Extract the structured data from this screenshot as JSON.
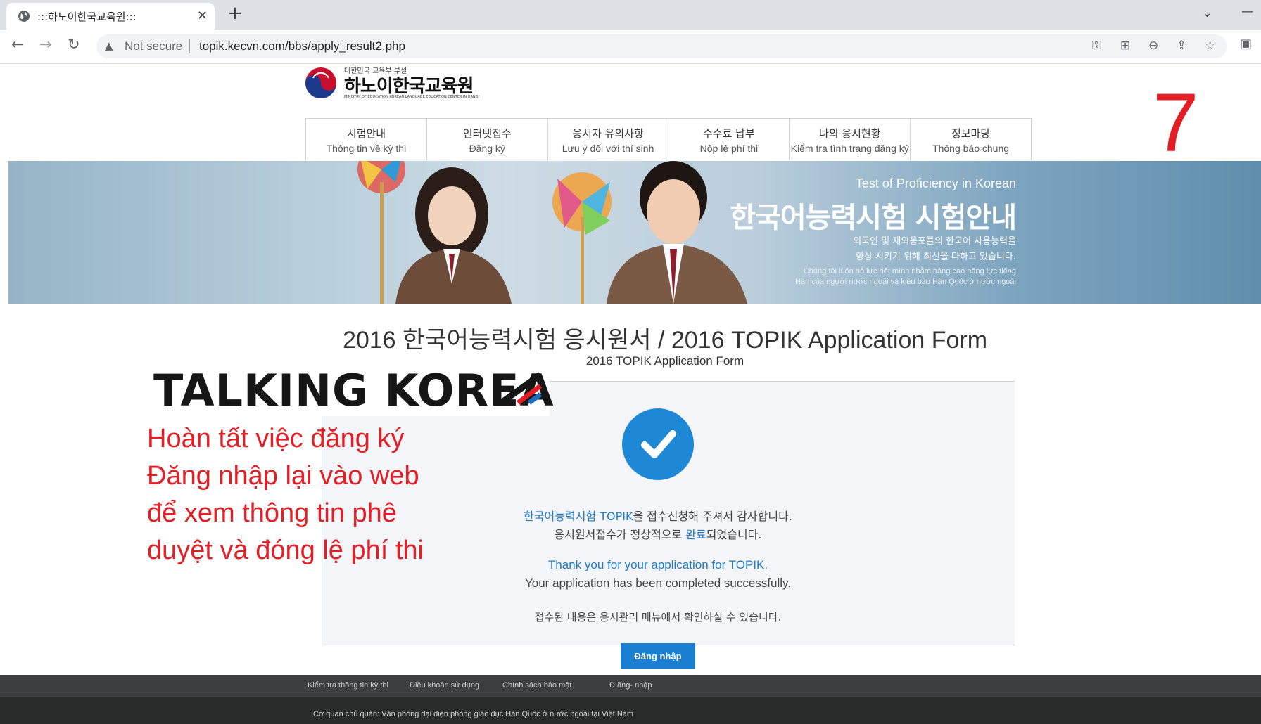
{
  "browser": {
    "tab_title": ":::하노이한국교육원:::",
    "tab_close": "✕",
    "new_tab": "+",
    "security_label": "Not secure",
    "url": "topik.kecvn.com/bbs/apply_result2.php",
    "icons": [
      "back-icon",
      "forward-icon",
      "reload-icon",
      "key-icon",
      "translate-icon",
      "zoom-icon",
      "share-icon",
      "star-icon",
      "extension-icon"
    ]
  },
  "header": {
    "logo_top": "대한민국 교육부 부설",
    "logo_main": "하노이한국교육원",
    "logo_sub": "MINISTRY OF EDUCATION KOREAN LANGUAGE EDUCATION CENTER IN HANOI",
    "step_number": "7"
  },
  "nav": [
    {
      "ko": "시험안내",
      "vi": "Thông tin về kỳ thi"
    },
    {
      "ko": "인터넷접수",
      "vi": "Đăng ký"
    },
    {
      "ko": "응시자 유의사항",
      "vi": "Lưu ý đối với thí sinh"
    },
    {
      "ko": "수수료 납부",
      "vi": "Nộp lệ phí thi"
    },
    {
      "ko": "나의 응시현황",
      "vi": "Kiểm tra tình trạng đăng ký"
    },
    {
      "ko": "정보마당",
      "vi": "Thông báo chung"
    }
  ],
  "banner": {
    "en": "Test of Proficiency in Korean",
    "ko": "한국어능력시험 시험안내",
    "desc_1": "외국인 및 재외동포들의 한국어 사용능력을",
    "desc_2": "향상 시키기 위해 최선을 다하고 있습니다.",
    "vi_1": "Chúng tôi luôn nỗ lực hết mình nhằm nâng cao năng lực tiếng",
    "vi_2": "Hàn của người nước ngoài và kiều bào Hàn Quốc ở nước ngoài"
  },
  "form": {
    "title": "2016 한국어능력시험 응시원서 / 2016 TOPIK Application Form",
    "subtitle": "2016 TOPIK Application Form"
  },
  "result": {
    "ko_line1_hl": "한국어능력시험 TOPIK",
    "ko_line1_rest": "을 접수신청해 주셔서 감사합니다.",
    "ko_line2_a": "응시원서접수가 정상적으로 ",
    "ko_line2_hl": "완료",
    "ko_line2_b": "되었습니다.",
    "en_line1": "Thank you for your application for TOPIK.",
    "en_line2": "Your application has been completed successfully.",
    "ko_line3": "접수된 내용은 응시관리 메뉴에서 확인하실 수 있습니다."
  },
  "login_button": "Đăng nhập",
  "overlay": {
    "brand": "TALKING KOREA",
    "note_1": "Hoàn tất việc đăng ký",
    "note_2": "Đăng nhập lại vào web",
    "note_3": "để xem thông tin phê",
    "note_4": "duyệt và đóng lệ phí thi",
    "accent_red": "#e31e24"
  },
  "footer": {
    "links": [
      "Kiểm tra thông tin kỳ thi",
      "Điều khoản sử dụng",
      "Chính sách bảo mật",
      "Đ ăng- nhập"
    ],
    "org": "Cơ quan chủ quản: Văn phòng đại diện phòng giáo dục Hàn Quốc ở nước ngoài tại Việt Nam"
  }
}
